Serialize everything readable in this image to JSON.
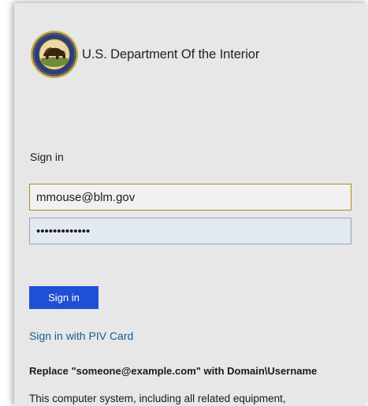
{
  "header": {
    "org_name": "U.S. Department Of the Interior",
    "seal_icon": "doi-bison-seal-icon"
  },
  "form": {
    "heading": "Sign in",
    "username_value": "mmouse@blm.gov",
    "password_mask": "•••••••••••••",
    "signin_button_label": "Sign in",
    "piv_link_label": "Sign in with PIV Card"
  },
  "hint": {
    "domain_hint": "Replace \"someone@example.com\" with Domain\\Username"
  },
  "footer": {
    "disclaimer_start": "This computer system, including all related equipment,"
  },
  "colors": {
    "card_background": "#e7e7e7",
    "button_blue": "#1f4fd4",
    "link_blue": "#0f5f96",
    "username_border": "#a98a1e",
    "password_fill": "#e3e9f1"
  }
}
